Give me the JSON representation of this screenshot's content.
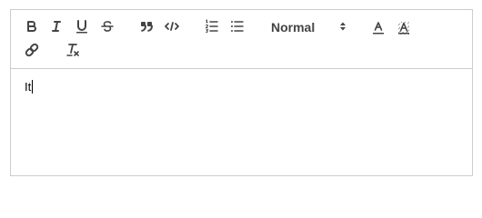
{
  "toolbar": {
    "buttons": [
      {
        "name": "bold-button",
        "icon": "bold-icon"
      },
      {
        "name": "italic-button",
        "icon": "italic-icon"
      },
      {
        "name": "underline-button",
        "icon": "underline-icon"
      },
      {
        "name": "strike-button",
        "icon": "strikethrough-icon"
      },
      {
        "name": "blockquote-button",
        "icon": "quote-icon"
      },
      {
        "name": "code-block-button",
        "icon": "code-icon"
      },
      {
        "name": "ordered-list-button",
        "icon": "ordered-list-icon"
      },
      {
        "name": "bullet-list-button",
        "icon": "bullet-list-icon"
      },
      {
        "name": "text-color-button",
        "icon": "text-color-icon"
      },
      {
        "name": "background-color-button",
        "icon": "background-color-icon"
      },
      {
        "name": "link-button",
        "icon": "link-icon"
      },
      {
        "name": "clear-format-button",
        "icon": "clear-format-icon"
      }
    ],
    "header_picker": {
      "selected": "Normal"
    }
  },
  "editor": {
    "content": "It"
  },
  "colors": {
    "icon": "#444444",
    "border": "#cccccc",
    "background": "#ffffff"
  }
}
